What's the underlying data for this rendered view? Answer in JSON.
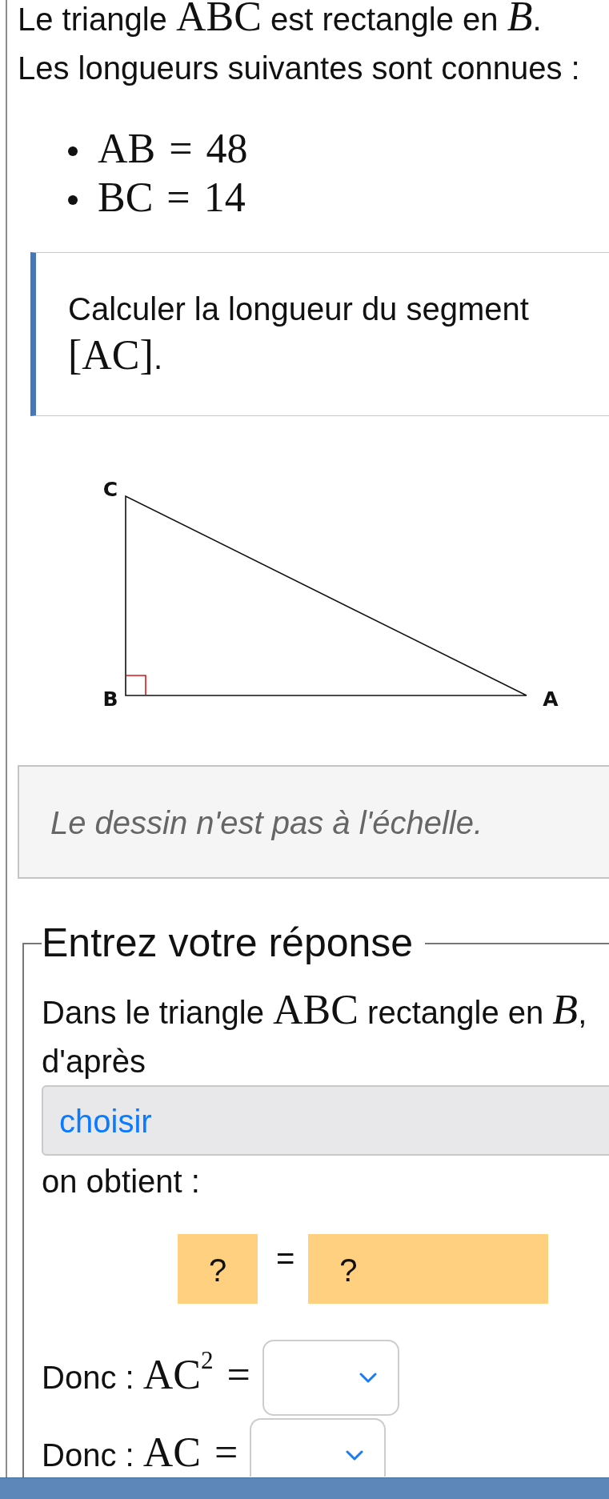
{
  "statement": [
    {
      "kind": "text",
      "text": "Le triangle "
    },
    {
      "kind": "math",
      "text": "ABC"
    },
    {
      "kind": "text",
      "text": " est rectangle en "
    },
    {
      "kind": "var",
      "text": "B"
    },
    {
      "kind": "text",
      "text": "."
    }
  ],
  "given_intro": "Les longueurs suivantes sont connues :",
  "given": [
    {
      "text": "AB = 48"
    },
    {
      "text": "BC = 14"
    }
  ],
  "task": [
    {
      "kind": "text",
      "text": "Calculer la longueur du segment "
    },
    {
      "kind": "math",
      "text": "[AC]"
    },
    {
      "kind": "text",
      "text": "."
    }
  ],
  "figure": {
    "vertices": [
      {
        "label": "C"
      },
      {
        "label": "B"
      },
      {
        "label": "A"
      }
    ],
    "right_angle_mark": true
  },
  "note": "Le dessin n'est pas à l'échelle.",
  "answer": {
    "legend": "Entrez votre réponse",
    "intro": [
      {
        "kind": "text",
        "text": "Dans le triangle "
      },
      {
        "kind": "math",
        "text": "ABC"
      },
      {
        "kind": "text",
        "text": " rectangle en "
      },
      {
        "kind": "var",
        "text": "B"
      },
      {
        "kind": "text",
        "text": ", d'après"
      }
    ],
    "method_select": {
      "label": "choisir"
    },
    "result_intro": "on obtient :",
    "equation": {
      "left": "?",
      "sign": "=",
      "right": "?"
    },
    "conclusions": [
      {
        "parts": [
          {
            "kind": "text",
            "text": "Donc : "
          },
          {
            "kind": "math",
            "text": "AC$^{2}$ ="
          }
        ]
      },
      {
        "parts": [
          {
            "kind": "text",
            "text": "Donc : "
          },
          {
            "kind": "math",
            "text": "AC ="
          }
        ]
      }
    ]
  }
}
